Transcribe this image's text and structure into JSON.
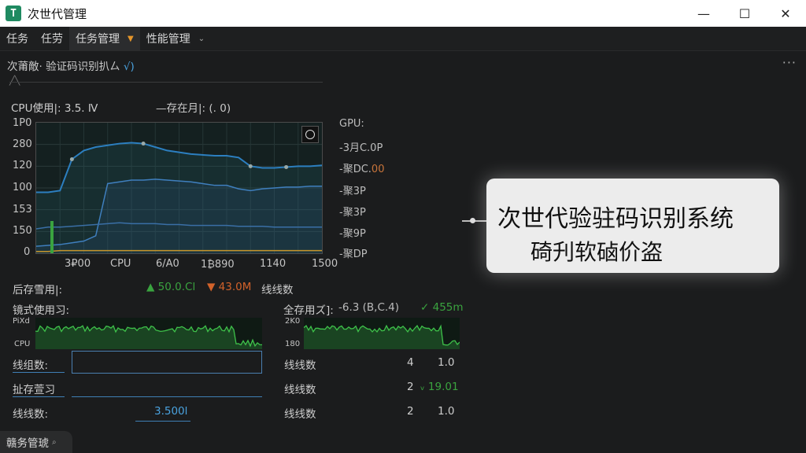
{
  "window": {
    "app_icon_glyph": "T",
    "title": "次世代管理",
    "minimize_glyph": "—",
    "maximize_glyph": "☐",
    "close_glyph": "✕"
  },
  "menubar": {
    "items": [
      "任务",
      "任劳",
      "任务管理",
      "性能管理"
    ],
    "active_caret": "▼",
    "dropdown_caret": "⌄"
  },
  "breadcrumb": {
    "part1": "次莆敵·",
    "part2": "验证码识别扒ㄙ",
    "part3": "√)"
  },
  "more_glyph": "···",
  "cpu": {
    "usage_label": "CPU使用|: 3.5. Ⅳ",
    "legend_label": "—存在月|: (. 0)"
  },
  "chart_data": {
    "type": "line",
    "y_tick_labels": [
      "1P0",
      "280",
      "120",
      "100",
      "153",
      "150",
      "0"
    ],
    "x_tick_labels": [
      "3₽00",
      "CPU",
      "6/A0",
      "1₿890",
      "1140",
      "1500"
    ],
    "series": [
      {
        "values": [
          70,
          70,
          72,
          108,
          118,
          122,
          124,
          126,
          127,
          126,
          122,
          118,
          116,
          114,
          113,
          112,
          112,
          110,
          100,
          98,
          98,
          99,
          100,
          100,
          101
        ]
      },
      {
        "values": [
          8,
          9,
          10,
          12,
          14,
          20,
          80,
          82,
          84,
          84,
          85,
          84,
          83,
          82,
          80,
          78,
          78,
          74,
          72,
          74,
          75,
          76,
          76,
          77,
          77
        ]
      },
      {
        "values": [
          28,
          30,
          30,
          31,
          32,
          33,
          34,
          35,
          34,
          34,
          34,
          33,
          33,
          32,
          32,
          32,
          32,
          31,
          31,
          31,
          30,
          30,
          30,
          30,
          30
        ]
      },
      {
        "values": [
          2,
          2,
          3,
          3,
          3,
          3,
          3,
          3,
          3,
          3,
          3,
          3,
          3,
          3,
          3,
          3,
          3,
          3,
          3,
          3,
          3,
          3,
          3,
          3,
          3
        ]
      }
    ],
    "colors": [
      "#2c7fc0",
      "#3f7fbe",
      "#3a6fa6",
      "#c8962b"
    ]
  },
  "gpu": {
    "title": "GPU:",
    "items": [
      "-3月C.0P",
      "-聚DC.00",
      "-聚3P",
      "-聚3P",
      "-聚9P",
      "-聚DP"
    ],
    "highlight_value": "00",
    "highlight_color": "#c8743a"
  },
  "callout": {
    "line1": "次世代验驻码识别系统",
    "line2": "碕刋软硵价盗"
  },
  "memory": {
    "label": "后存雪用|:",
    "value1": "▲ 50.0.Cl",
    "value2": "▼ 43.0M",
    "value3": "线线数",
    "up_color": "#3aa33f",
    "down_color": "#d2622a"
  },
  "panel_left": {
    "title": "镜式使用习:",
    "y_top": "PiXd",
    "y_bottom": "CPU"
  },
  "panel_right": {
    "title": "全存用ズ]:",
    "value1": "-6.3 (B,C.4)",
    "value2": "✓ 455m",
    "y_top": "2K0",
    "y_bottom": "180"
  },
  "rows_left": [
    {
      "label": "线组数:"
    },
    {
      "label": "扯存萱习"
    },
    {
      "label": "线线数:",
      "value": "3.500l"
    }
  ],
  "rows_right": [
    {
      "label": "线线数",
      "num": "4",
      "val": "1.0"
    },
    {
      "label": "线线数",
      "num": "2",
      "val": "ᵥ 19.01"
    },
    {
      "label": "线线数",
      "num": "2",
      "val": "1.0"
    }
  ],
  "statusbar": {
    "label": "赣务管琥",
    "glyph": "⌕"
  }
}
